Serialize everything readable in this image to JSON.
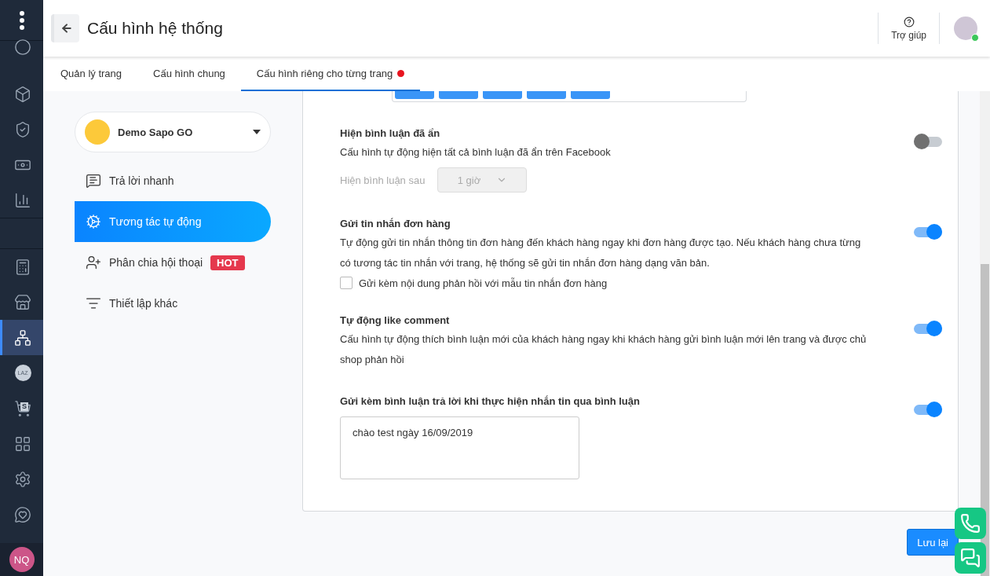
{
  "sidebar": {
    "items": [
      {
        "selected": false
      },
      {
        "selected": false
      },
      {
        "selected": false
      },
      {
        "selected": false
      },
      {
        "selected": false
      },
      {
        "selected": false
      },
      {
        "selected": false
      },
      {
        "selected": true
      },
      {
        "text": "LAZ",
        "selected": false
      },
      {
        "text": "S",
        "selected": false
      },
      {
        "selected": false
      },
      {
        "selected": false
      },
      {
        "selected": false
      }
    ],
    "user_initials": "NQ"
  },
  "header": {
    "title": "Cấu hình hệ thống",
    "help": "Trợ giúp"
  },
  "tabs": [
    {
      "label": "Quản lý trang",
      "selected": false,
      "dot": false
    },
    {
      "label": "Cấu hình chung",
      "selected": false,
      "dot": false
    },
    {
      "label": "Cấu hình riêng cho từng trang",
      "selected": true,
      "dot": true
    }
  ],
  "page_select": {
    "name": "Demo Sapo GO"
  },
  "menu": [
    {
      "label": "Trả lời nhanh",
      "selected": false
    },
    {
      "label": "Tương tác tự động",
      "selected": true
    },
    {
      "label": "Phân chia hội thoại",
      "selected": false,
      "badge": "HOT"
    },
    {
      "label": "Thiết lập khác",
      "selected": false
    }
  ],
  "settings": [
    {
      "kind": "select",
      "title": "Hiện bình luận đã ẩn",
      "description": "Cấu hình tự động hiện tất cả bình luận đã ẩn trên Facebook",
      "on": false,
      "field_label": "Hiện bình luận sau",
      "field_value": "1 giờ",
      "disabled": true
    },
    {
      "kind": "checkbox",
      "title": "Gửi tin nhắn đơn hàng",
      "description": "Tự động gửi tin nhắn thông tin đơn hàng đến khách hàng ngay khi đơn hàng được tạo. Nếu khách hàng chưa từng có tương tác tin nhắn với trang, hệ thống sẽ gửi tin nhắn đơn hàng dạng văn bản.",
      "on": true,
      "checkbox_label": "Gửi kèm nội dung phản hồi với mẫu tin nhắn đơn hàng",
      "checked": false
    },
    {
      "kind": "plain",
      "title": "Tự động like comment",
      "description": "Cấu hình tự động thích bình luận mới của khách hàng ngay khi khách hàng gửi bình luận mới lên trang và được chủ shop phản hồi",
      "on": true
    },
    {
      "kind": "textarea",
      "title": "Gửi kèm bình luận trả lời khi thực hiện nhắn tin qua bình luận",
      "on": true,
      "value": "chào test ngày 16/09/2019"
    }
  ],
  "save_button": "Lưu lại"
}
